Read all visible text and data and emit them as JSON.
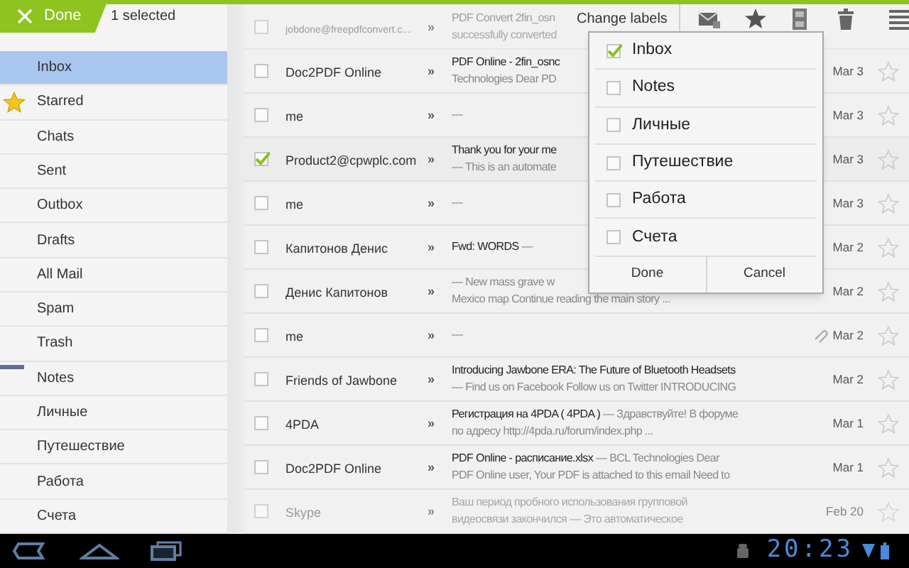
{
  "action_bar": {
    "done": "Done",
    "selection": "1 selected",
    "change_labels": "Change labels"
  },
  "sidebar": {
    "items": [
      {
        "label": "Inbox",
        "kind": "folder",
        "selected": true
      },
      {
        "label": "Starred",
        "kind": "starred",
        "selected": false
      },
      {
        "label": "Chats",
        "kind": "folder",
        "selected": false
      },
      {
        "label": "Sent",
        "kind": "folder",
        "selected": false
      },
      {
        "label": "Outbox",
        "kind": "folder",
        "selected": false
      },
      {
        "label": "Drafts",
        "kind": "folder",
        "selected": false
      },
      {
        "label": "All Mail",
        "kind": "folder",
        "selected": false
      },
      {
        "label": "Spam",
        "kind": "folder",
        "selected": false
      },
      {
        "label": "Trash",
        "kind": "folder",
        "selected": false
      },
      {
        "label": "Notes",
        "kind": "label",
        "selected": false
      },
      {
        "label": "Личные",
        "kind": "label",
        "selected": false
      },
      {
        "label": "Путешествие",
        "kind": "label",
        "selected": false
      },
      {
        "label": "Работа",
        "kind": "label",
        "selected": false
      },
      {
        "label": "Счета",
        "kind": "label",
        "selected": false
      }
    ]
  },
  "messages": [
    {
      "sender": "jobdone@freepdfconvert.c...",
      "marker": "»",
      "checked": false,
      "dimmed": true,
      "lines": [
        {
          "subject": "PDF Convert 2fin_osn"
        },
        {
          "snippet": "successfully converted"
        }
      ]
    },
    {
      "sender": "Doc2PDF Online",
      "marker": "»",
      "checked": false,
      "dimmed": false,
      "lines": [
        {
          "subject": "PDF Online - 2fin_osnc"
        },
        {
          "snippet": "Technologies Dear PD"
        }
      ],
      "date": "Mar 3",
      "starred": false,
      "attachment": false
    },
    {
      "sender": "me",
      "marker": "»",
      "checked": false,
      "dimmed": false,
      "lines": [
        {
          "snippet": "—"
        }
      ],
      "date": "Mar 3",
      "starred": false,
      "attachment": false
    },
    {
      "sender": "Product2@cpwplc.com",
      "marker": "»",
      "checked": true,
      "dimmed": false,
      "lines": [
        {
          "subject": "Thank you for your me"
        },
        {
          "snippet": "— This is an automate"
        }
      ],
      "date": "Mar 3",
      "starred": false,
      "attachment": false
    },
    {
      "sender": "me",
      "marker": "»",
      "checked": false,
      "dimmed": false,
      "lines": [
        {
          "snippet": "—"
        }
      ],
      "date": "Mar 3",
      "starred": false,
      "attachment": false
    },
    {
      "sender": "Капитонов Денис",
      "marker": "»",
      "checked": false,
      "dimmed": false,
      "lines": [
        {
          "subject": "Fwd: WORDS",
          "snippet": "—"
        }
      ],
      "date": "Mar 2",
      "starred": false,
      "attachment": false
    },
    {
      "sender": "Денис Капитонов",
      "marker": "»",
      "checked": false,
      "dimmed": false,
      "lines": [
        {
          "snippet": "— New mass grave w"
        },
        {
          "snippet": "Mexico map Continue reading the main story ..."
        }
      ],
      "date": "Mar 2",
      "starred": false,
      "attachment": false
    },
    {
      "sender": "me",
      "marker": "»",
      "checked": false,
      "dimmed": false,
      "lines": [
        {
          "snippet": "—"
        }
      ],
      "date": "Mar 2",
      "starred": false,
      "attachment": true
    },
    {
      "sender": "Friends of Jawbone",
      "marker": "»",
      "checked": false,
      "dimmed": false,
      "lines": [
        {
          "subject": "Introducing Jawbone ERA: The Future of Bluetooth Headsets"
        },
        {
          "snippet": "— Find us on Facebook Follow us on Twitter INTRODUCING"
        }
      ],
      "date": "Mar 2",
      "starred": false,
      "attachment": false
    },
    {
      "sender": "4PDA",
      "marker": "»",
      "checked": false,
      "dimmed": false,
      "lines": [
        {
          "subject": "Регистрация на 4PDA ( 4PDA )",
          "snippet": "— Здравствуйте! В форуме"
        },
        {
          "snippet": "по адресу http://4pda.ru/forum/index.php ..."
        }
      ],
      "date": "Mar 1",
      "starred": false,
      "attachment": false
    },
    {
      "sender": "Doc2PDF Online",
      "marker": "»",
      "checked": false,
      "dimmed": false,
      "lines": [
        {
          "subject": "PDF Online - расписание.xlsx",
          "snippet": "— BCL Technologies Dear"
        },
        {
          "snippet": "PDF Online user, Your PDF is attached to this email Need to"
        }
      ],
      "date": "Mar 1",
      "starred": false,
      "attachment": false
    },
    {
      "sender": "Skype",
      "marker": "»",
      "checked": false,
      "dimmed": true,
      "lines": [
        {
          "snippet": "Ваш период пробного использования групповой"
        },
        {
          "snippet": "видеосвязи закончился — Это автоматическое"
        }
      ],
      "date": "Feb 20",
      "starred": false,
      "attachment": false
    }
  ],
  "label_dialog": {
    "options": [
      {
        "label": "Inbox",
        "checked": true
      },
      {
        "label": "Notes",
        "checked": false
      },
      {
        "label": "Личные",
        "checked": false
      },
      {
        "label": "Путешествие",
        "checked": false
      },
      {
        "label": "Работа",
        "checked": false
      },
      {
        "label": "Счета",
        "checked": false
      }
    ],
    "buttons": [
      "Done",
      "Cancel"
    ]
  },
  "status_bar": {
    "time": "20:23"
  }
}
